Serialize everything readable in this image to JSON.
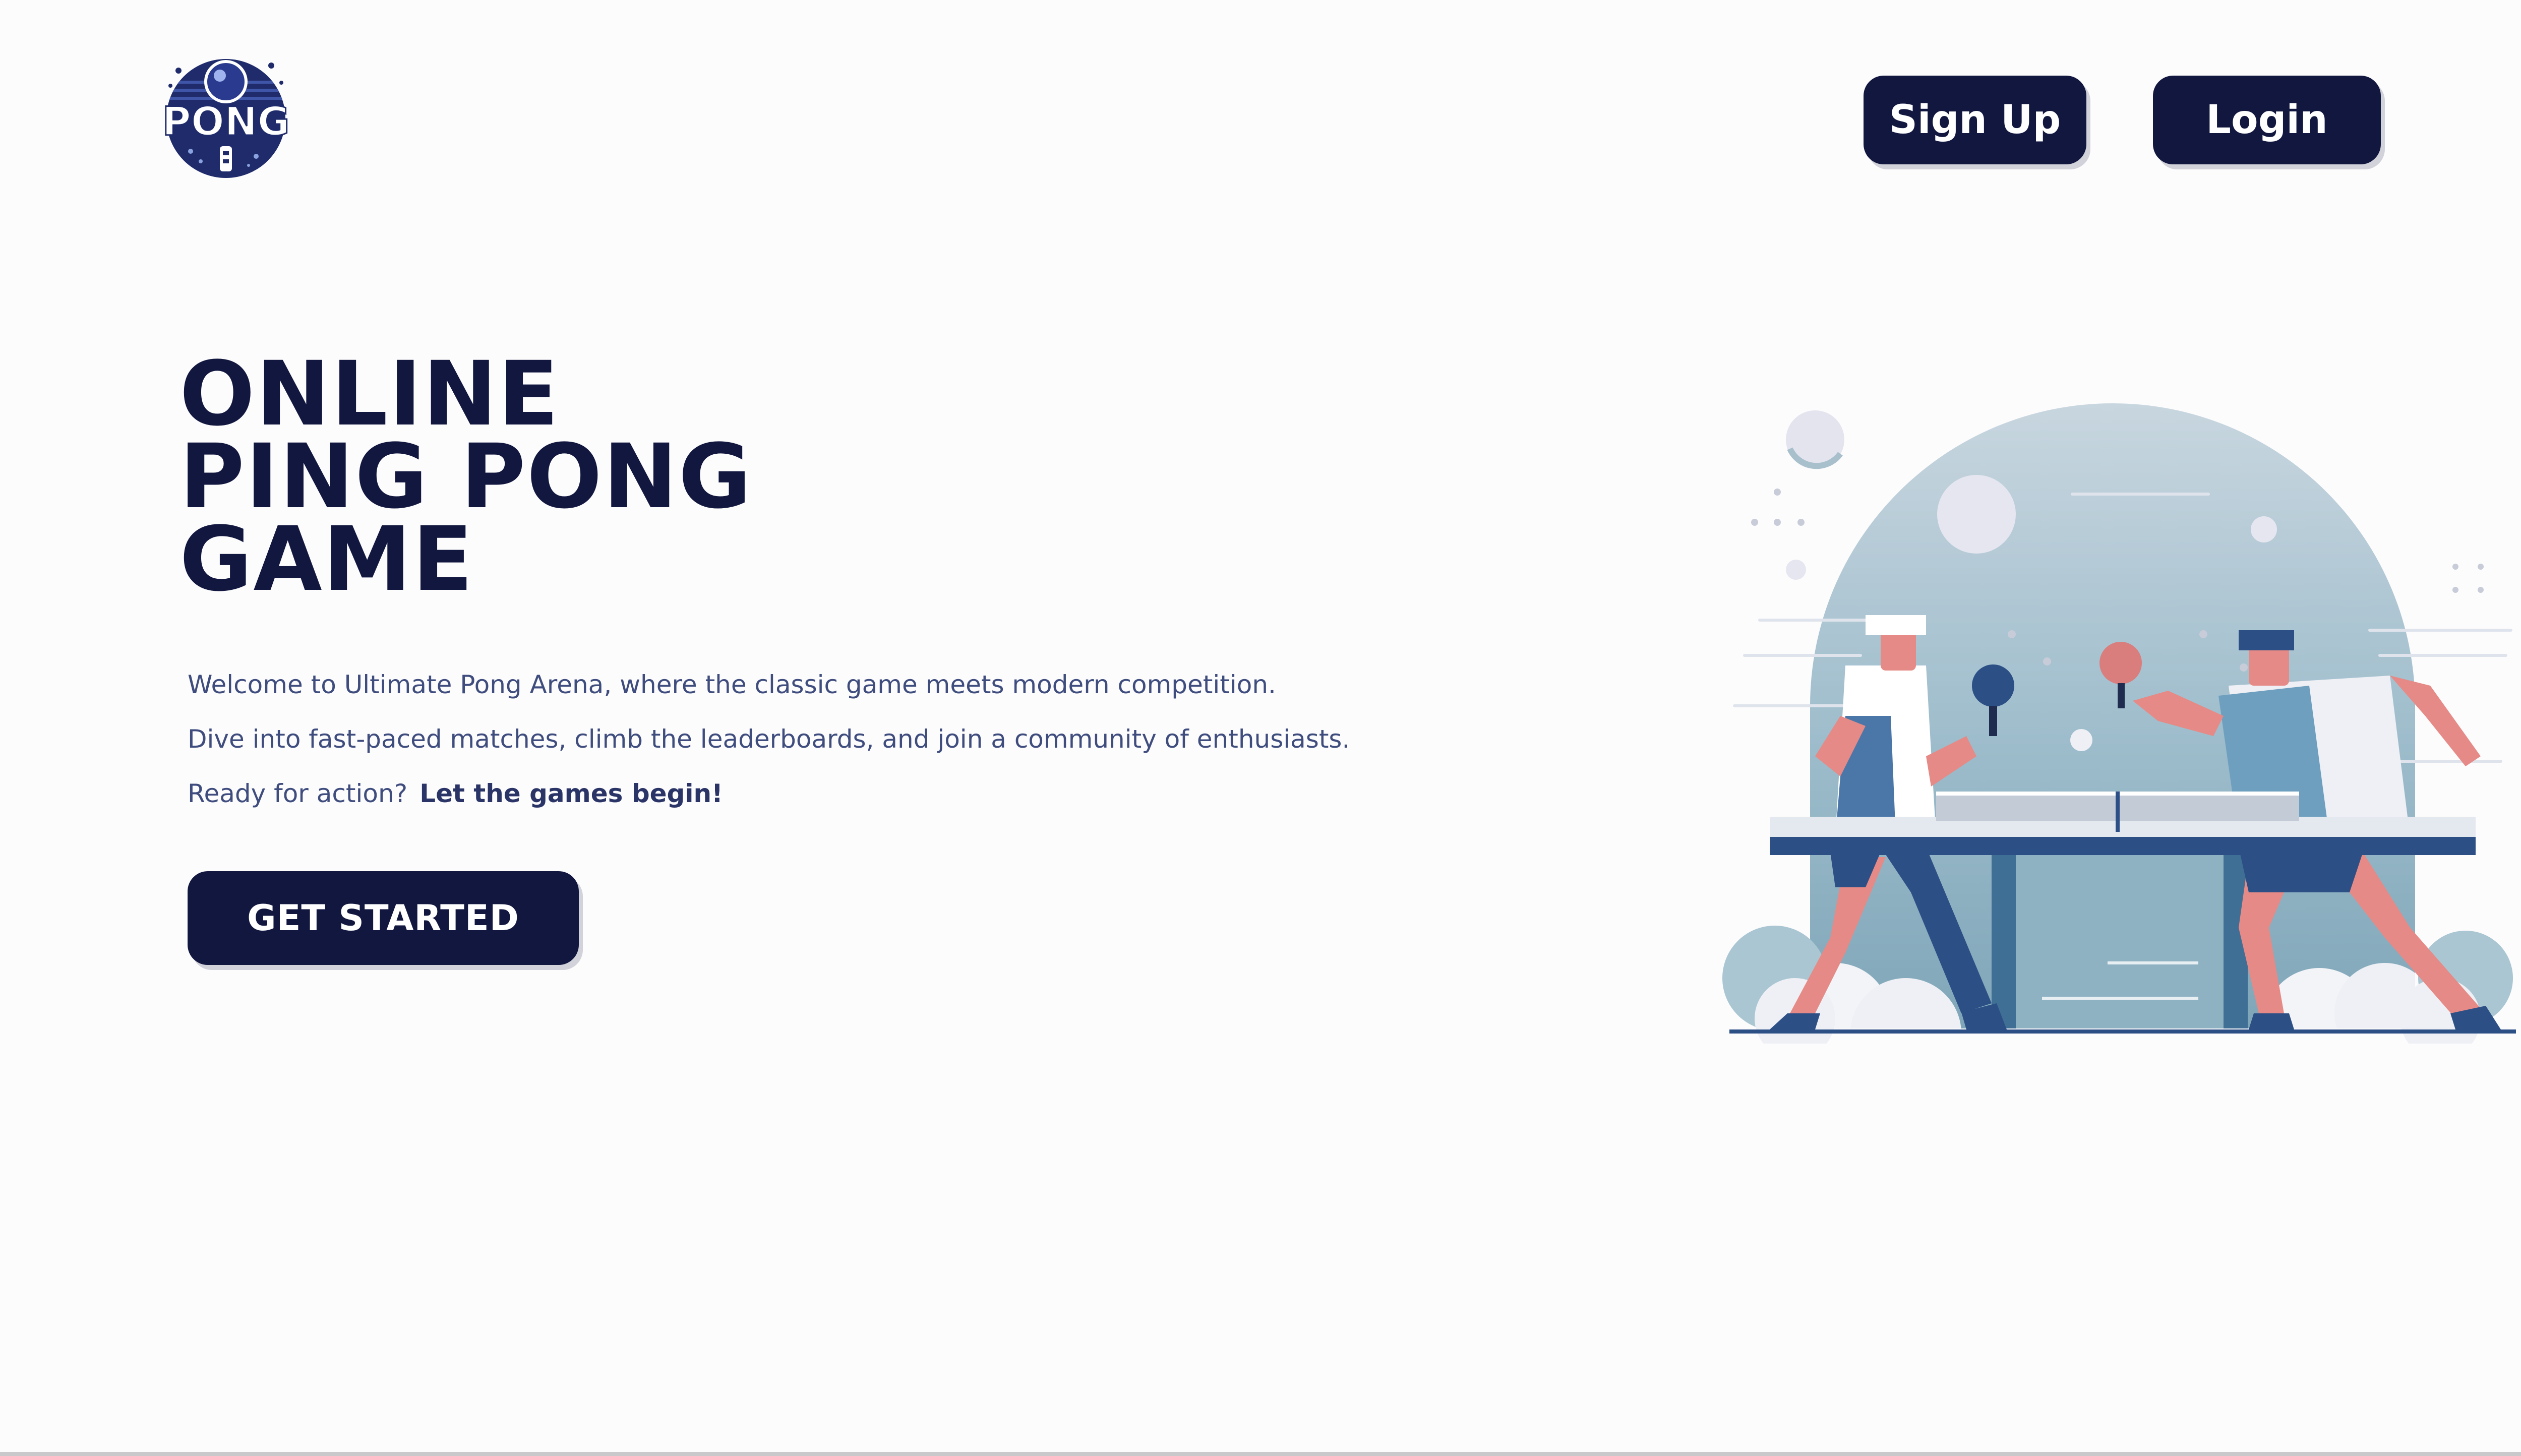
{
  "logo": {
    "text": "PONG",
    "icon": "pong-logo-icon"
  },
  "header": {
    "signup_label": "Sign Up",
    "login_label": "Login"
  },
  "hero": {
    "title_lines": [
      "ONLINE",
      "PING PONG",
      "GAME"
    ],
    "description": [
      "Welcome to Ultimate Pong Arena, where the classic game meets modern competition.",
      "Dive into fast-paced matches, climb the leaderboards, and join a community of enthusiasts."
    ],
    "ready_text": "Ready for action?",
    "cta_text": "Let the games begin!",
    "get_started_label": "GET STARTED",
    "illustration_icon": "ping-pong-players-illustration"
  },
  "colors": {
    "primary": "#12173f",
    "text": "#3f4d7e",
    "background": "#fdfcfd",
    "accent_blue": "#7fa6b8",
    "accent_pink": "#e58a86"
  }
}
